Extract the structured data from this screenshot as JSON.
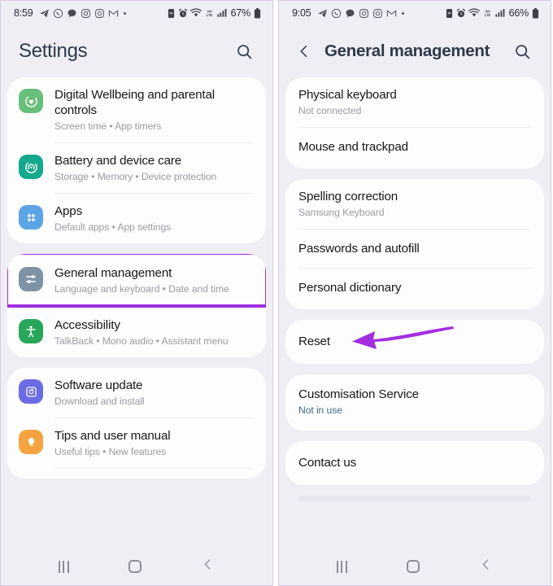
{
  "left": {
    "status": {
      "time": "8:59",
      "battery_percent": "67%",
      "left_icons": [
        "telegram-icon",
        "whatsapp-icon",
        "chat-bubble-icon",
        "instagram-icon",
        "camera-icon",
        "gmail-icon",
        "overflow-dot-icon"
      ],
      "right_icons": [
        "dnd-icon",
        "alarm-icon",
        "wifi-icon",
        "volte-icon",
        "signal-icon",
        "battery-icon"
      ]
    },
    "header": {
      "title": "Settings",
      "search_icon": "search-icon"
    },
    "cards": [
      {
        "rows": [
          {
            "title": "Digital Wellbeing and parental controls",
            "sub": "Screen time  •  App timers",
            "icon": "wellbeing-icon",
            "icon_color": "#67bf7a"
          },
          {
            "title": "Battery and device care",
            "sub": "Storage  •  Memory  •  Device protection",
            "icon": "battery-care-icon",
            "icon_color": "#14a98c"
          },
          {
            "title": "Apps",
            "sub": "Default apps  •  App settings",
            "icon": "apps-grid-icon",
            "icon_color": "#5ba4e5"
          }
        ]
      },
      {
        "highlighted": true,
        "rows": [
          {
            "title": "General management",
            "sub": "Language and keyboard  •  Date and time",
            "icon": "sliders-icon",
            "icon_color": "#7e93a6"
          },
          {
            "title": "Accessibility",
            "sub": "TalkBack  •  Mono audio  •  Assistant menu",
            "icon": "accessibility-icon",
            "icon_color": "#28a65a"
          }
        ]
      },
      {
        "rows": [
          {
            "title": "Software update",
            "sub": "Download and install",
            "icon": "software-update-icon",
            "icon_color": "#6b6ce4"
          },
          {
            "title": "Tips and user manual",
            "sub": "Useful tips  •  New features",
            "icon": "lightbulb-icon",
            "icon_color": "#f5a340"
          }
        ]
      }
    ],
    "nav": {
      "recent": "recent-apps-icon",
      "home": "home-icon",
      "back": "back-icon"
    }
  },
  "right": {
    "status": {
      "time": "9:05",
      "battery_percent": "66%",
      "left_icons": [
        "telegram-icon",
        "whatsapp-icon",
        "chat-bubble-icon",
        "instagram-icon",
        "camera-icon",
        "gmail-icon",
        "overflow-dot-icon"
      ],
      "right_icons": [
        "dnd-icon",
        "alarm-icon",
        "wifi-icon",
        "volte-icon",
        "signal-icon",
        "battery-icon"
      ]
    },
    "header": {
      "back_icon": "back-chevron-icon",
      "title": "General management",
      "search_icon": "search-icon"
    },
    "cards": [
      {
        "rows": [
          {
            "title": "Physical keyboard",
            "sub": "Not connected"
          },
          {
            "title": "Mouse and trackpad",
            "sub": ""
          }
        ]
      },
      {
        "rows": [
          {
            "title": "Spelling correction",
            "sub": "Samsung Keyboard"
          },
          {
            "title": "Passwords and autofill",
            "sub": ""
          },
          {
            "title": "Personal dictionary",
            "sub": ""
          }
        ]
      },
      {
        "annotated": true,
        "rows": [
          {
            "title": "Reset",
            "sub": ""
          }
        ]
      },
      {
        "rows": [
          {
            "title": "Customisation Service",
            "sub": "Not in use",
            "sub_style": "blue"
          }
        ]
      },
      {
        "rows": [
          {
            "title": "Contact us",
            "sub": ""
          }
        ]
      }
    ],
    "nav": {
      "recent": "recent-apps-icon",
      "home": "home-icon",
      "back": "back-icon"
    }
  },
  "annotations": {
    "highlight_color": "#a32ee0",
    "arrow_color": "#a32ee0",
    "arrow_target": "Reset"
  }
}
